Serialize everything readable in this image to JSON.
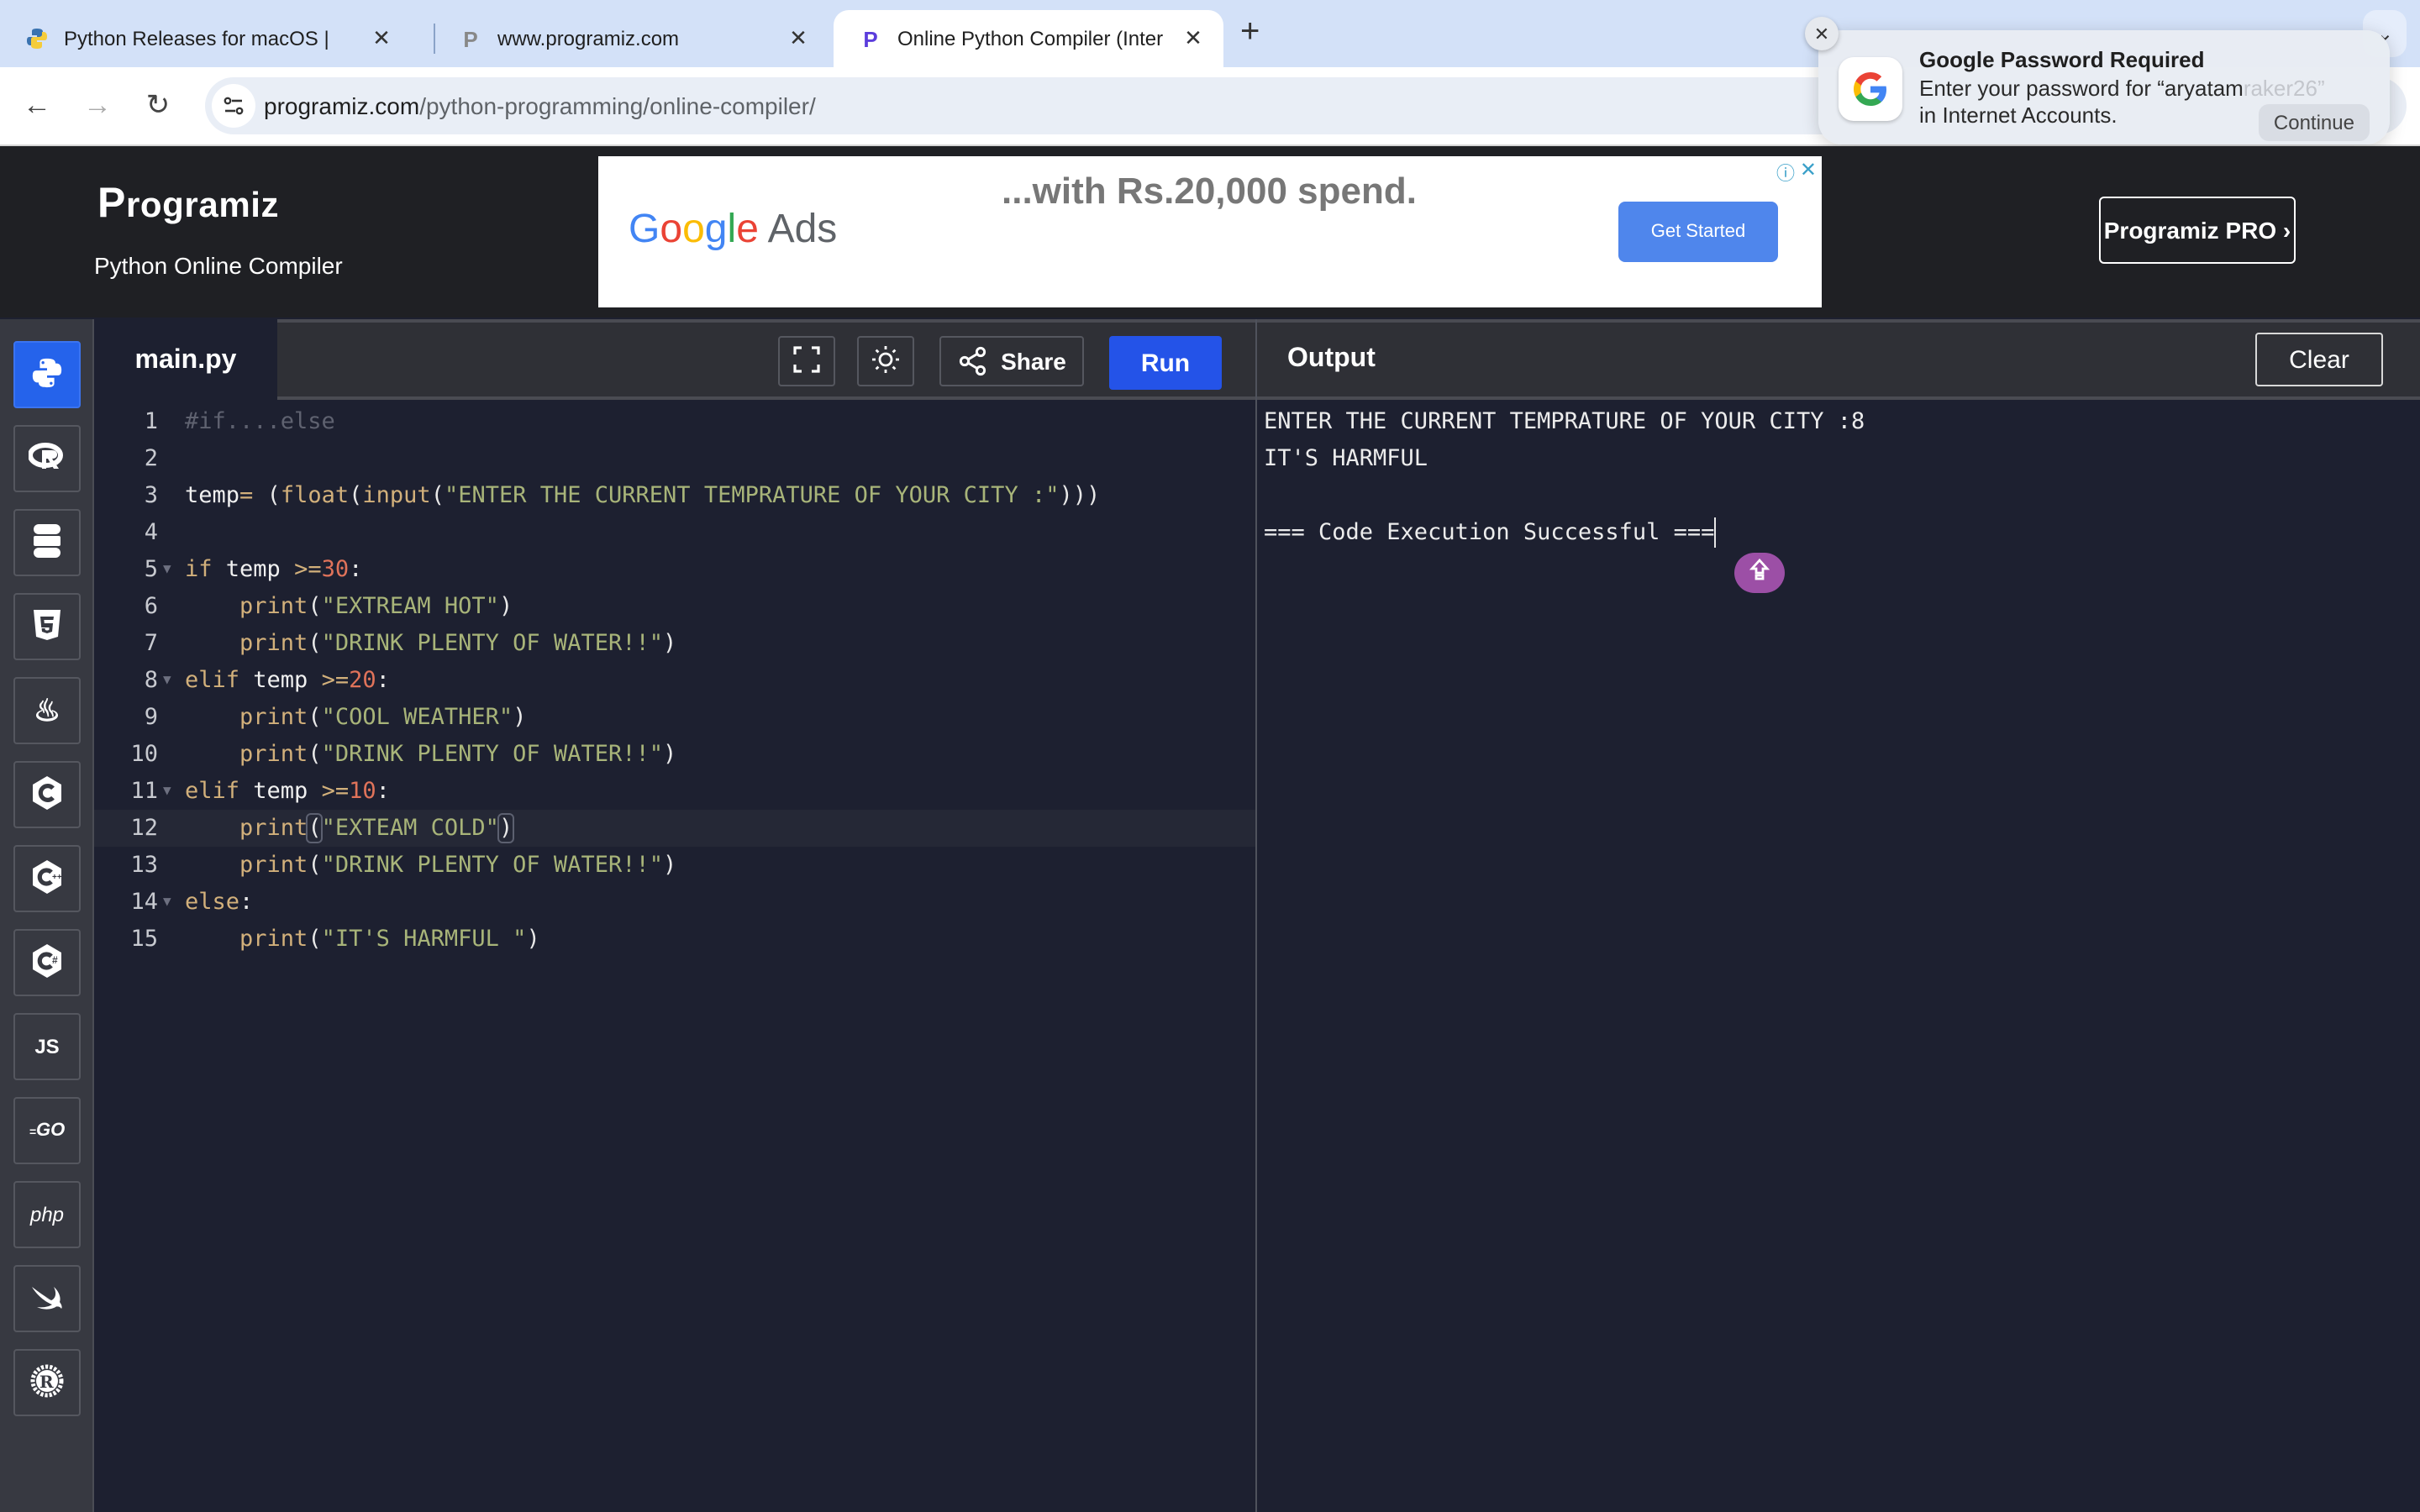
{
  "browser": {
    "tabs": [
      {
        "title": "Python Releases for macOS |",
        "favicon": "python-icon",
        "active": false
      },
      {
        "title": "www.programiz.com",
        "favicon": "programiz-icon",
        "active": false
      },
      {
        "title": "Online Python Compiler (Inter",
        "favicon": "programiz-icon",
        "active": true
      }
    ],
    "new_tab_label": "+",
    "close_glyph": "✕",
    "url_host": "programiz.com",
    "url_path": "/python-programming/online-compiler/"
  },
  "notification": {
    "title": "Google Password Required",
    "body_prefix": "Enter your password for “aryatam",
    "body_faded": "raker26”",
    "body_line2": "in Internet Accounts.",
    "button": "Continue"
  },
  "site": {
    "logo": "rogramiz",
    "logo_initial": "P",
    "subtitle": "Python Online Compiler",
    "pro_button": "Programiz PRO ›"
  },
  "ad": {
    "brand_suffix": "Ads",
    "headline": "...with Rs.20,000 spend.",
    "cta": "Get Started"
  },
  "languages": [
    {
      "name": "Python",
      "icon": "python-icon",
      "active": true
    },
    {
      "name": "R",
      "icon": "r-icon",
      "active": false
    },
    {
      "name": "SQL",
      "icon": "database-icon",
      "active": false
    },
    {
      "name": "HTML",
      "icon": "html5-icon",
      "active": false
    },
    {
      "name": "Java",
      "icon": "java-icon",
      "active": false
    },
    {
      "name": "C",
      "icon": "c-icon",
      "active": false
    },
    {
      "name": "C++",
      "icon": "cpp-icon",
      "active": false
    },
    {
      "name": "C#",
      "icon": "csharp-icon",
      "active": false
    },
    {
      "name": "JavaScript",
      "icon": "js-icon",
      "label": "JS",
      "active": false
    },
    {
      "name": "Go",
      "icon": "go-icon",
      "label": "GO",
      "active": false
    },
    {
      "name": "PHP",
      "icon": "php-icon",
      "label": "php",
      "active": false
    },
    {
      "name": "Swift",
      "icon": "swift-icon",
      "active": false
    },
    {
      "name": "Rust",
      "icon": "rust-icon",
      "active": false
    }
  ],
  "editor": {
    "file_name": "main.py",
    "share_label": "Share",
    "run_label": "Run",
    "highlighted_line": 12,
    "lines": [
      {
        "n": "1",
        "fold": false,
        "tokens": [
          [
            "comment",
            "#if....else"
          ]
        ]
      },
      {
        "n": "2",
        "fold": false,
        "tokens": []
      },
      {
        "n": "3",
        "fold": false,
        "tokens": [
          [
            "id",
            "temp"
          ],
          [
            "op",
            "="
          ],
          [
            "p",
            " ("
          ],
          [
            "fn",
            "float"
          ],
          [
            "p",
            "("
          ],
          [
            "fn",
            "input"
          ],
          [
            "p",
            "("
          ],
          [
            "str",
            "\"ENTER THE CURRENT TEMPRATURE OF YOUR CITY :\""
          ],
          [
            "p",
            ")))"
          ]
        ]
      },
      {
        "n": "4",
        "fold": false,
        "tokens": []
      },
      {
        "n": "5",
        "fold": true,
        "tokens": [
          [
            "kw",
            "if"
          ],
          [
            "id",
            " temp "
          ],
          [
            "op",
            ">="
          ],
          [
            "num",
            "30"
          ],
          [
            "p",
            ":"
          ]
        ]
      },
      {
        "n": "6",
        "fold": false,
        "tokens": [
          [
            "p",
            "    "
          ],
          [
            "fn",
            "print"
          ],
          [
            "p",
            "("
          ],
          [
            "str",
            "\"EXTREAM HOT\""
          ],
          [
            "p",
            ")"
          ]
        ]
      },
      {
        "n": "7",
        "fold": false,
        "tokens": [
          [
            "p",
            "    "
          ],
          [
            "fn",
            "print"
          ],
          [
            "p",
            "("
          ],
          [
            "str",
            "\"DRINK PLENTY OF WATER!!\""
          ],
          [
            "p",
            ")"
          ]
        ]
      },
      {
        "n": "8",
        "fold": true,
        "tokens": [
          [
            "kw",
            "elif"
          ],
          [
            "id",
            " temp "
          ],
          [
            "op",
            ">="
          ],
          [
            "num",
            "20"
          ],
          [
            "p",
            ":"
          ]
        ]
      },
      {
        "n": "9",
        "fold": false,
        "tokens": [
          [
            "p",
            "    "
          ],
          [
            "fn",
            "print"
          ],
          [
            "p",
            "("
          ],
          [
            "str",
            "\"COOL WEATHER\""
          ],
          [
            "p",
            ")"
          ]
        ]
      },
      {
        "n": "10",
        "fold": false,
        "tokens": [
          [
            "p",
            "    "
          ],
          [
            "fn",
            "print"
          ],
          [
            "p",
            "("
          ],
          [
            "str",
            "\"DRINK PLENTY OF WATER!!\""
          ],
          [
            "p",
            ")"
          ]
        ]
      },
      {
        "n": "11",
        "fold": true,
        "tokens": [
          [
            "kw",
            "elif"
          ],
          [
            "id",
            " temp "
          ],
          [
            "op",
            ">="
          ],
          [
            "num",
            "10"
          ],
          [
            "p",
            ":"
          ]
        ]
      },
      {
        "n": "12",
        "fold": false,
        "tokens": [
          [
            "p",
            "    "
          ],
          [
            "fn",
            "print"
          ],
          [
            "pb",
            "("
          ],
          [
            "str",
            "\"EXTEAM COLD\""
          ],
          [
            "pb",
            ")"
          ]
        ]
      },
      {
        "n": "13",
        "fold": false,
        "tokens": [
          [
            "p",
            "    "
          ],
          [
            "fn",
            "print"
          ],
          [
            "p",
            "("
          ],
          [
            "str",
            "\"DRINK PLENTY OF WATER!!\""
          ],
          [
            "p",
            ")"
          ]
        ]
      },
      {
        "n": "14",
        "fold": true,
        "tokens": [
          [
            "kw",
            "else"
          ],
          [
            "p",
            ":"
          ]
        ]
      },
      {
        "n": "15",
        "fold": false,
        "tokens": [
          [
            "p",
            "    "
          ],
          [
            "fn",
            "print"
          ],
          [
            "p",
            "("
          ],
          [
            "str",
            "\"IT'S HARMFUL \""
          ],
          [
            "p",
            ")"
          ]
        ]
      }
    ]
  },
  "output": {
    "title": "Output",
    "clear_label": "Clear",
    "lines": [
      "ENTER THE CURRENT TEMPRATURE OF YOUR CITY :8",
      "IT'S HARMFUL",
      "",
      "=== Code Execution Successful ==="
    ]
  },
  "colors": {
    "run_button": "#2453e8",
    "active_language": "#2563eb",
    "editor_bg": "#1d2030",
    "header_bg": "#1f2024",
    "tabstrip_bg": "#d3e1f8",
    "floating_button": "#9c4fa6"
  }
}
